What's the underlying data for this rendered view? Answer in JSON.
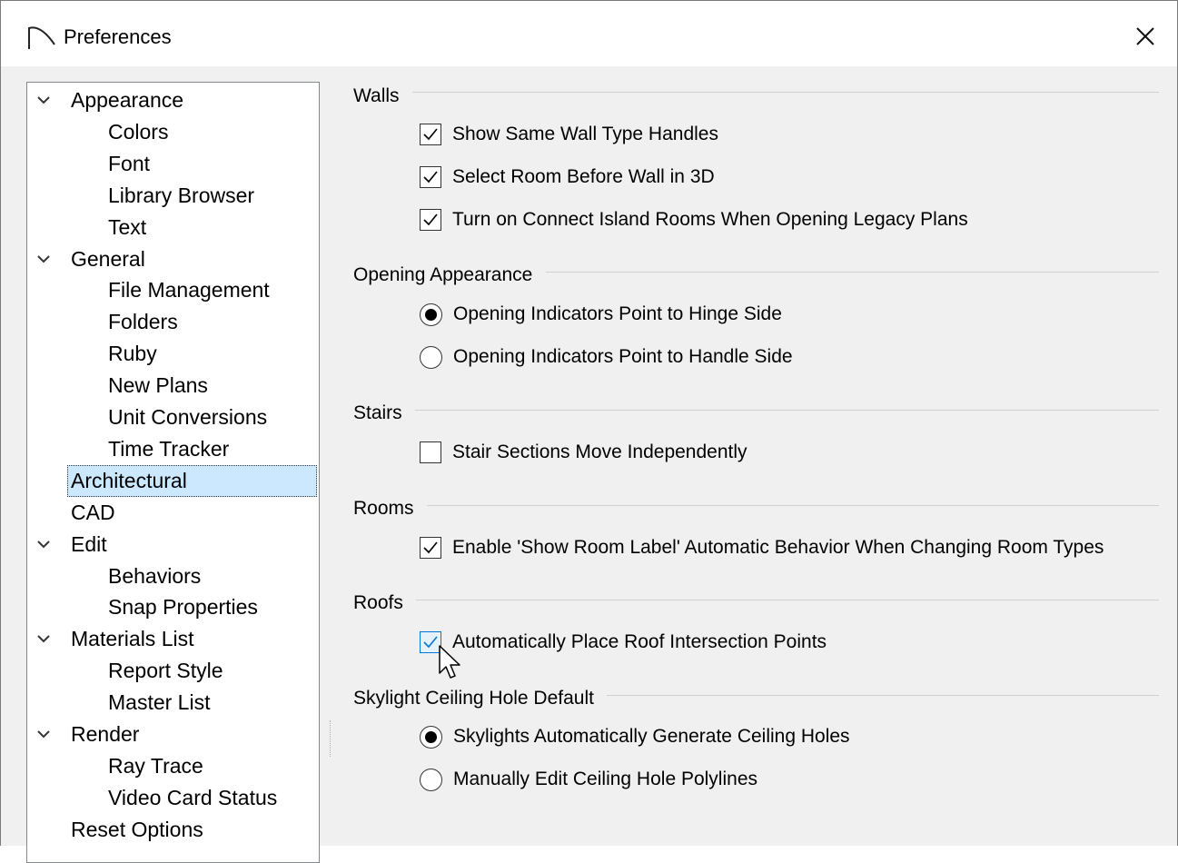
{
  "window": {
    "title": "Preferences"
  },
  "tree": [
    {
      "label": "Appearance",
      "level": 0,
      "expandable": true
    },
    {
      "label": "Colors",
      "level": 1
    },
    {
      "label": "Font",
      "level": 1
    },
    {
      "label": "Library Browser",
      "level": 1
    },
    {
      "label": "Text",
      "level": 1
    },
    {
      "label": "General",
      "level": 0,
      "expandable": true
    },
    {
      "label": "File Management",
      "level": 1
    },
    {
      "label": "Folders",
      "level": 1
    },
    {
      "label": "Ruby",
      "level": 1
    },
    {
      "label": "New Plans",
      "level": 1
    },
    {
      "label": "Unit Conversions",
      "level": 1
    },
    {
      "label": "Time Tracker",
      "level": 1
    },
    {
      "label": "Architectural",
      "level": 0,
      "selected": true
    },
    {
      "label": "CAD",
      "level": 0
    },
    {
      "label": "Edit",
      "level": 0,
      "expandable": true
    },
    {
      "label": "Behaviors",
      "level": 1
    },
    {
      "label": "Snap Properties",
      "level": 1
    },
    {
      "label": "Materials List",
      "level": 0,
      "expandable": true
    },
    {
      "label": "Report Style",
      "level": 1
    },
    {
      "label": "Master List",
      "level": 1
    },
    {
      "label": "Render",
      "level": 0,
      "expandable": true
    },
    {
      "label": "Ray Trace",
      "level": 1
    },
    {
      "label": "Video Card Status",
      "level": 1
    },
    {
      "label": "Reset Options",
      "level": 0
    }
  ],
  "groups": {
    "walls": {
      "title": "Walls",
      "options": [
        {
          "label": "Show Same Wall Type Handles",
          "checked": true
        },
        {
          "label": "Select Room Before Wall in 3D",
          "checked": true
        },
        {
          "label": "Turn on Connect Island Rooms When Opening Legacy Plans",
          "checked": true
        }
      ]
    },
    "opening": {
      "title": "Opening Appearance",
      "options": [
        {
          "label": "Opening Indicators Point to Hinge Side",
          "selected": true
        },
        {
          "label": "Opening Indicators Point to Handle Side",
          "selected": false
        }
      ]
    },
    "stairs": {
      "title": "Stairs",
      "options": [
        {
          "label": "Stair Sections Move Independently",
          "checked": false
        }
      ]
    },
    "rooms": {
      "title": "Rooms",
      "options": [
        {
          "label": "Enable 'Show Room Label' Automatic Behavior When Changing Room Types",
          "checked": true
        }
      ]
    },
    "roofs": {
      "title": "Roofs",
      "options": [
        {
          "label": "Automatically Place Roof Intersection Points",
          "checked": true
        }
      ]
    },
    "skylight": {
      "title": "Skylight Ceiling Hole Default",
      "options": [
        {
          "label": "Skylights Automatically Generate Ceiling Holes",
          "selected": true
        },
        {
          "label": "Manually Edit Ceiling Hole Polylines",
          "selected": false
        }
      ]
    }
  },
  "colors": {
    "selection": "#cce8ff",
    "hot": "#0078d7"
  }
}
